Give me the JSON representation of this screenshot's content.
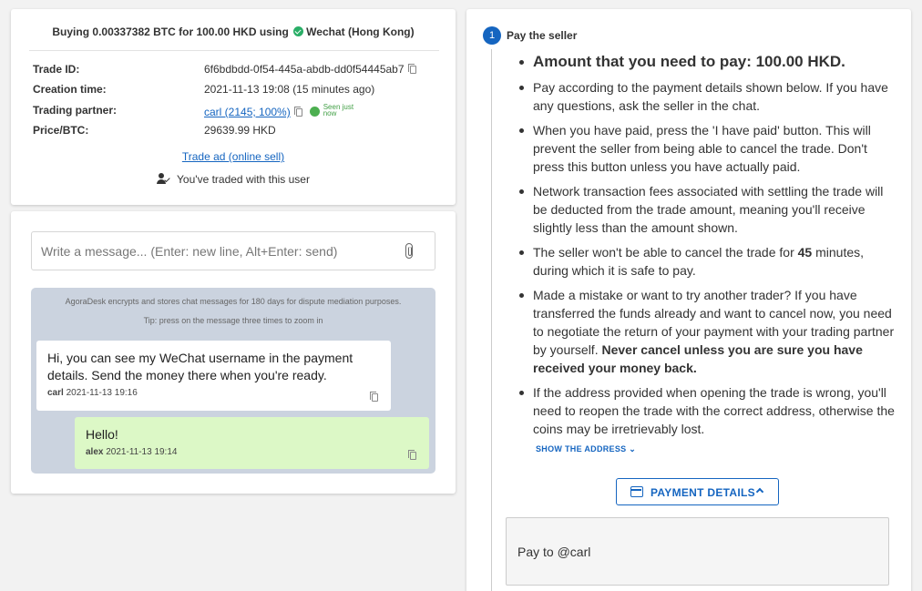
{
  "trade": {
    "title_prefix": "Buying 0.00337382 BTC for 100.00 HKD using",
    "payment_method": "Wechat (Hong Kong)",
    "fields": [
      {
        "label": "Trade ID:",
        "value": "6f6bdbdd-0f54-445a-abdb-dd0f54445ab7"
      },
      {
        "label": "Creation time:",
        "value": "2021-11-13 19:08 (15 minutes ago)"
      },
      {
        "label": "Trading partner:",
        "value": "carl (2145; 100%)"
      },
      {
        "label": "Price/BTC:",
        "value": "29639.99 HKD"
      }
    ],
    "seen_status": "Seen just now",
    "trade_ad_link": "Trade ad (online sell)",
    "traded_note": "You've traded with this user"
  },
  "chat": {
    "input_placeholder": "Write a message... (Enter: new line, Alt+Enter: send)",
    "notice": "AgoraDesk encrypts and stores chat messages for 180 days for dispute mediation purposes.",
    "tip": "Tip: press on the message three times to zoom in",
    "messages": [
      {
        "text": "Hi, you can see my WeChat username in the payment details. Send the money there when you're ready.",
        "author": "carl",
        "time": "2021-11-13 19:16"
      },
      {
        "text": "Hello!",
        "author": "alex",
        "time": "2021-11-13 19:14"
      }
    ]
  },
  "instructions": {
    "step_number": "1",
    "step_title": "Pay the seller",
    "amount_text": "Amount that you need to pay: 100.00 HKD.",
    "items": [
      "Pay according to the payment details shown below. If you have any questions, ask the seller in the chat.",
      "When you have paid, press the 'I have paid' button. This will prevent the seller from being able to cancel the trade. Don't press this button unless you have actually paid.",
      "Network transaction fees associated with settling the trade will be deducted from the trade amount, meaning you'll receive slightly less than the amount shown."
    ],
    "cancel_prefix": "The seller won't be able to cancel the trade for ",
    "cancel_minutes": "45",
    "cancel_suffix": " minutes, during which it is safe to pay.",
    "mistake_text": "Made a mistake or want to try another trader? If you have transferred the funds already and want to cancel now, you need to negotiate the return of your payment with your trading partner by yourself. ",
    "mistake_bold": "Never cancel unless you are sure you have received your money back.",
    "address_text": "If the address provided when opening the trade is wrong, you'll need to reopen the trade with the correct address, otherwise the coins may be irretrievably lost.",
    "show_address": "SHOW THE ADDRESS",
    "payment_details_button": "PAYMENT DETAILS",
    "pay_to": "Pay to @carl"
  },
  "colors": {
    "accent": "#1565c0",
    "online": "#4caf50",
    "wechat": "#2aae67",
    "chat_bg": "#cbd3df",
    "own_bubble": "#dcf8c6"
  }
}
